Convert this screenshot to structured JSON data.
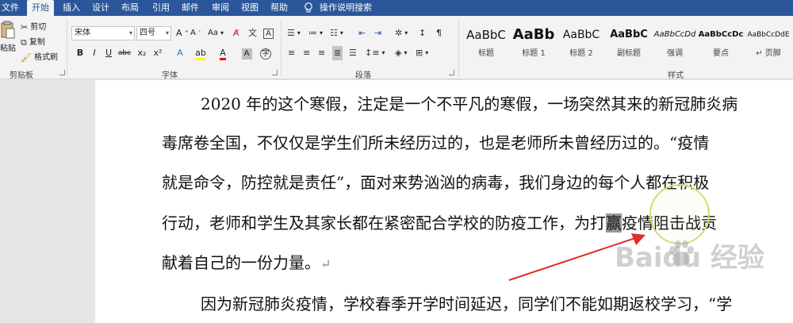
{
  "tabs": [
    "文件",
    "开始",
    "插入",
    "设计",
    "布局",
    "引用",
    "邮件",
    "审阅",
    "视图",
    "帮助"
  ],
  "active_tab": "开始",
  "tell_me": "操作说明搜索",
  "clipboard": {
    "paste": "粘贴",
    "cut": "剪切",
    "copy": "复制",
    "format_painter": "格式刷",
    "group_label": "剪贴板"
  },
  "font": {
    "name": "宋体",
    "size": "四号",
    "group_label": "字体",
    "buttons": [
      "B",
      "I",
      "U",
      "abc",
      "x₂",
      "x²"
    ],
    "grow": "A",
    "shrink": "A",
    "case": "Aa"
  },
  "paragraph": {
    "group_label": "段落"
  },
  "styles": {
    "group_label": "样式",
    "items": [
      {
        "sample": "AaBbC",
        "name": "标题"
      },
      {
        "sample": "AaBb",
        "name": "标题 1"
      },
      {
        "sample": "AaBbC",
        "name": "标题 2"
      },
      {
        "sample": "AaBbC",
        "name": "副标题"
      },
      {
        "sample": "AaBbCcDd",
        "name": "强调"
      },
      {
        "sample": "AaBbCcDc",
        "name": "要点"
      },
      {
        "sample": "AaBbCcDdE",
        "name": "页脚"
      }
    ]
  },
  "document": {
    "lines": [
      "2020 年的这个寒假，注定是一个不平凡的寒假，一场突然其来的新冠肺炎病",
      "毒席卷全国，不仅仅是学生们所未经历过的，也是老师所未曾经历过的。“疫情",
      "就是命令，防控就是责任”，面对来势汹汹的病毒，我们身边的每个人都在积极",
      "行动，老师和学生及其家长都在紧密配合学校的防疫工作，为打",
      "赢",
      "疫情阻击战贡",
      "献着自己的一份力量。",
      "因为新冠肺炎疫情，学校春季开学时间延迟，同学们不能如期返校学习，“学"
    ],
    "paragraph_mark": "↵"
  },
  "watermark": "Baidu 经验",
  "colors": {
    "accent": "#2b579a",
    "arrow": "#e0302a",
    "highlight": "#ffff00",
    "font_color": "#ff0000"
  }
}
